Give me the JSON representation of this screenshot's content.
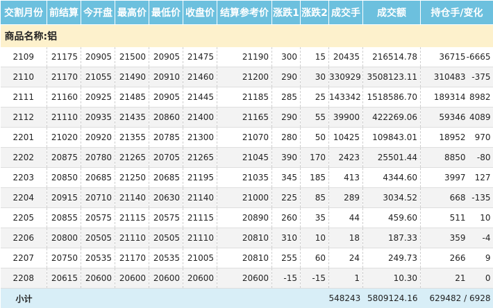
{
  "headers": [
    "交割月份",
    "前结算",
    "今开盘",
    "最高价",
    "最低价",
    "收盘价",
    "结算参考价",
    "涨跌1",
    "涨跌2",
    "成交手",
    "成交额",
    "持仓手/变化"
  ],
  "commodity_label": "商品名称:铝",
  "rows": [
    {
      "month": "2109",
      "prev_settle": "21175",
      "open": "20905",
      "high": "21500",
      "low": "20905",
      "close": "21475",
      "settle_ref": "21190",
      "chg1": "300",
      "chg2": "15",
      "volume": "20435",
      "turnover": "216514.78",
      "oi": "36715",
      "oi_chg": "-6665"
    },
    {
      "month": "2110",
      "prev_settle": "21170",
      "open": "21055",
      "high": "21490",
      "low": "20910",
      "close": "21460",
      "settle_ref": "21200",
      "chg1": "290",
      "chg2": "30",
      "volume": "330929",
      "turnover": "3508123.11",
      "oi": "310483",
      "oi_chg": "-375"
    },
    {
      "month": "2111",
      "prev_settle": "21160",
      "open": "20925",
      "high": "21485",
      "low": "20905",
      "close": "21445",
      "settle_ref": "21185",
      "chg1": "285",
      "chg2": "25",
      "volume": "143342",
      "turnover": "1518586.70",
      "oi": "189314",
      "oi_chg": "8982"
    },
    {
      "month": "2112",
      "prev_settle": "21110",
      "open": "20935",
      "high": "21435",
      "low": "20860",
      "close": "21400",
      "settle_ref": "21165",
      "chg1": "290",
      "chg2": "55",
      "volume": "39900",
      "turnover": "422269.06",
      "oi": "59346",
      "oi_chg": "4089"
    },
    {
      "month": "2201",
      "prev_settle": "21020",
      "open": "20920",
      "high": "21355",
      "low": "20785",
      "close": "21300",
      "settle_ref": "21070",
      "chg1": "280",
      "chg2": "50",
      "volume": "10425",
      "turnover": "109843.01",
      "oi": "18952",
      "oi_chg": "970"
    },
    {
      "month": "2202",
      "prev_settle": "20875",
      "open": "20780",
      "high": "21265",
      "low": "20705",
      "close": "21265",
      "settle_ref": "21045",
      "chg1": "390",
      "chg2": "170",
      "volume": "2423",
      "turnover": "25501.44",
      "oi": "8850",
      "oi_chg": "-80"
    },
    {
      "month": "2203",
      "prev_settle": "20850",
      "open": "20685",
      "high": "21250",
      "low": "20685",
      "close": "21195",
      "settle_ref": "21035",
      "chg1": "345",
      "chg2": "185",
      "volume": "413",
      "turnover": "4344.60",
      "oi": "3997",
      "oi_chg": "127"
    },
    {
      "month": "2204",
      "prev_settle": "20915",
      "open": "20710",
      "high": "21140",
      "low": "20630",
      "close": "21140",
      "settle_ref": "21000",
      "chg1": "225",
      "chg2": "85",
      "volume": "289",
      "turnover": "3034.52",
      "oi": "668",
      "oi_chg": "-135"
    },
    {
      "month": "2205",
      "prev_settle": "20855",
      "open": "20575",
      "high": "21115",
      "low": "20575",
      "close": "21115",
      "settle_ref": "20890",
      "chg1": "260",
      "chg2": "35",
      "volume": "44",
      "turnover": "459.60",
      "oi": "511",
      "oi_chg": "10"
    },
    {
      "month": "2206",
      "prev_settle": "20800",
      "open": "20505",
      "high": "21110",
      "low": "20505",
      "close": "21110",
      "settle_ref": "20810",
      "chg1": "310",
      "chg2": "10",
      "volume": "18",
      "turnover": "187.33",
      "oi": "359",
      "oi_chg": "-4"
    },
    {
      "month": "2207",
      "prev_settle": "20750",
      "open": "20535",
      "high": "21170",
      "low": "20535",
      "close": "21005",
      "settle_ref": "20810",
      "chg1": "255",
      "chg2": "60",
      "volume": "24",
      "turnover": "249.73",
      "oi": "266",
      "oi_chg": "9"
    },
    {
      "month": "2208",
      "prev_settle": "20615",
      "open": "20600",
      "high": "20600",
      "low": "20600",
      "close": "20600",
      "settle_ref": "20600",
      "chg1": "-15",
      "chg2": "-15",
      "volume": "1",
      "turnover": "10.30",
      "oi": "21",
      "oi_chg": "0"
    }
  ],
  "total": {
    "label": "小计",
    "volume": "548243",
    "turnover": "5809124.16",
    "oi": "629482 / 6928"
  }
}
